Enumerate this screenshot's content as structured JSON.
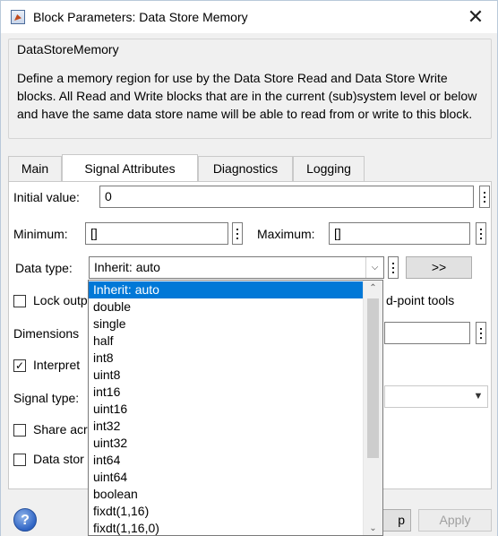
{
  "window": {
    "title": "Block Parameters: Data Store Memory",
    "close_symbol": "✕"
  },
  "block": {
    "type_name": "DataStoreMemory",
    "description": "Define a memory region for use by the Data Store Read and Data Store Write blocks. All Read and Write blocks that are in the current (sub)system level or below and have the same data store name will be able to read from or write to this block."
  },
  "tabs": [
    {
      "label": "Main"
    },
    {
      "label": "Signal Attributes",
      "active": true
    },
    {
      "label": "Diagnostics"
    },
    {
      "label": "Logging"
    }
  ],
  "form": {
    "initial_value_label": "Initial value:",
    "initial_value": "0",
    "minimum_label": "Minimum:",
    "minimum_value": "[]",
    "maximum_label": "Maximum:",
    "maximum_value": "[]",
    "data_type_label": "Data type:",
    "data_type_value": "Inherit: auto",
    "assistant_button": ">>",
    "lock_output_label": "Lock outp",
    "lock_output_suffix": "d-point tools",
    "dimensions_label": "Dimensions",
    "interpret_label": "Interpret",
    "signal_type_label": "Signal type:",
    "share_label": "Share acr",
    "data_store_label": "Data stor"
  },
  "checkboxes": {
    "lock_output": false,
    "interpret": true,
    "share": false,
    "data_store": false
  },
  "dropdown": {
    "selected_index": 0,
    "options": [
      "Inherit: auto",
      "double",
      "single",
      "half",
      "int8",
      "uint8",
      "int16",
      "uint16",
      "int32",
      "uint32",
      "int64",
      "uint64",
      "boolean",
      "fixdt(1,16)",
      "fixdt(1,16,0)"
    ]
  },
  "footer": {
    "help_symbol": "?",
    "hidden_button_tail": "p",
    "apply_label": "Apply"
  },
  "colors": {
    "selection": "#0078d7",
    "dialog_bg": "#f0f0f0",
    "help_icon": "#2f64c4"
  }
}
